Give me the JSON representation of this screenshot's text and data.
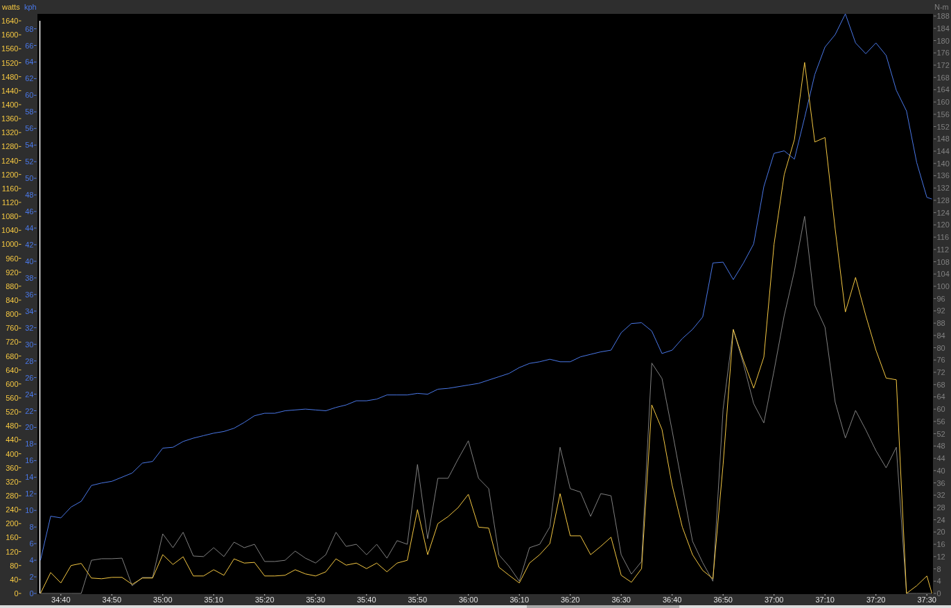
{
  "charts": [
    {
      "chart_data": {
        "type": "line",
        "ylabel": "watts",
        "x": [
          2076,
          2078,
          2080,
          2082,
          2084,
          2086,
          2088,
          2090,
          2092,
          2094,
          2096,
          2098,
          2100,
          2102,
          2104,
          2106,
          2108,
          2110,
          2112,
          2114,
          2116,
          2118,
          2120,
          2122,
          2124,
          2126,
          2128,
          2130,
          2132,
          2134,
          2136,
          2138,
          2140,
          2142,
          2144,
          2146,
          2148,
          2150,
          2152,
          2154,
          2156,
          2158,
          2160,
          2162,
          2164,
          2166,
          2168,
          2170,
          2172,
          2174,
          2176,
          2178,
          2180,
          2182,
          2184,
          2186,
          2188,
          2190,
          2192,
          2194,
          2196,
          2198,
          2200,
          2202,
          2204,
          2206,
          2208,
          2210,
          2212,
          2214,
          2216,
          2218,
          2220,
          2222,
          2224,
          2226,
          2228,
          2230,
          2232,
          2234,
          2236,
          2238,
          2240,
          2242,
          2244,
          2246,
          2248,
          2250,
          2251
        ],
        "xlim": [
          2075.4,
          2251.2
        ],
        "xticks": [
          {
            "value": 2080,
            "label": "34:40"
          },
          {
            "value": 2090,
            "label": "34:50"
          },
          {
            "value": 2100,
            "label": "35:00"
          },
          {
            "value": 2110,
            "label": "35:10"
          },
          {
            "value": 2120,
            "label": "35:20"
          },
          {
            "value": 2130,
            "label": "35:30"
          },
          {
            "value": 2140,
            "label": "35:40"
          },
          {
            "value": 2150,
            "label": "35:50"
          },
          {
            "value": 2160,
            "label": "36:00"
          },
          {
            "value": 2170,
            "label": "36:10"
          },
          {
            "value": 2180,
            "label": "36:20"
          },
          {
            "value": 2190,
            "label": "36:30"
          },
          {
            "value": 2200,
            "label": "36:40"
          },
          {
            "value": 2210,
            "label": "36:50"
          },
          {
            "value": 2220,
            "label": "37:00"
          },
          {
            "value": 2230,
            "label": "37:10"
          },
          {
            "value": 2240,
            "label": "37:20"
          },
          {
            "value": 2250,
            "label": "37:30"
          }
        ],
        "ylim": [
          0,
          1660
        ],
        "yticks": [
          0,
          40,
          80,
          120,
          160,
          200,
          240,
          280,
          320,
          360,
          400,
          440,
          480,
          520,
          560,
          600,
          640,
          680,
          720,
          760,
          800,
          840,
          880,
          920,
          960,
          1000,
          1040,
          1080,
          1120,
          1160,
          1200,
          1240,
          1280,
          1320,
          1360,
          1400,
          1440,
          1480,
          1520,
          1560,
          1600,
          1640
        ],
        "series": [
          {
            "color": "#f5c842",
            "values": [
              0,
              60,
              30,
              80,
              86,
              44,
              42,
              46,
              46,
              26,
              44,
              44,
              111,
              83,
              105,
              50,
              50,
              68,
              52,
              99,
              87,
              89,
              50,
              50,
              52,
              68,
              56,
              50,
              62,
              99,
              81,
              87,
              71,
              87,
              62,
              87,
              95,
              240,
              111,
              200,
              220,
              246,
              284,
              190,
              187,
              75,
              52,
              30,
              87,
              111,
              143,
              286,
              165,
              165,
              111,
              135,
              161,
              52,
              32,
              71,
              540,
              470,
              310,
              190,
              111,
              66,
              42,
              369,
              756,
              667,
              588,
              677,
              1000,
              1200,
              1300,
              1521,
              1293,
              1306,
              1044,
              806,
              905,
              796,
              697,
              617,
              612,
              0,
              22,
              50,
              0
            ]
          }
        ]
      }
    },
    {
      "chart_data": {
        "type": "line",
        "ylabel": "kph",
        "x": [
          2076,
          2078,
          2080,
          2082,
          2084,
          2086,
          2088,
          2090,
          2092,
          2094,
          2096,
          2098,
          2100,
          2102,
          2104,
          2106,
          2108,
          2110,
          2112,
          2114,
          2116,
          2118,
          2120,
          2122,
          2124,
          2126,
          2128,
          2130,
          2132,
          2134,
          2136,
          2138,
          2140,
          2142,
          2144,
          2146,
          2148,
          2150,
          2152,
          2154,
          2156,
          2158,
          2160,
          2162,
          2164,
          2166,
          2168,
          2170,
          2172,
          2174,
          2176,
          2178,
          2180,
          2182,
          2184,
          2186,
          2188,
          2190,
          2192,
          2194,
          2196,
          2198,
          2200,
          2202,
          2204,
          2206,
          2208,
          2210,
          2212,
          2214,
          2216,
          2218,
          2220,
          2222,
          2224,
          2226,
          2228,
          2230,
          2232,
          2234,
          2236,
          2238,
          2240,
          2242,
          2244,
          2246,
          2248,
          2250,
          2251
        ],
        "xlim": [
          2075.4,
          2251.2
        ],
        "ylim": [
          0,
          69.8
        ],
        "yticks": [
          0,
          2,
          4,
          6,
          8,
          10,
          12,
          14,
          16,
          18,
          20,
          22,
          24,
          26,
          28,
          30,
          32,
          34,
          36,
          38,
          40,
          42,
          44,
          46,
          48,
          50,
          52,
          54,
          56,
          58,
          60,
          62,
          64,
          66,
          68
        ],
        "series": [
          {
            "color": "#4a78e8",
            "values": [
              4,
              9.3,
              9.1,
              10.4,
              11.1,
              13,
              13.3,
              13.5,
              14,
              14.5,
              15.7,
              15.9,
              17.5,
              17.6,
              18.3,
              18.7,
              19,
              19.3,
              19.5,
              19.9,
              20.6,
              21.4,
              21.7,
              21.7,
              22,
              22.1,
              22.2,
              22.1,
              22,
              22.4,
              22.7,
              23.2,
              23.2,
              23.4,
              23.9,
              23.9,
              23.9,
              24.1,
              24,
              24.6,
              24.7,
              24.9,
              25.1,
              25.3,
              25.7,
              26.1,
              26.5,
              27.2,
              27.7,
              27.9,
              28.2,
              27.9,
              27.9,
              28.5,
              28.8,
              29.1,
              29.3,
              31.4,
              32.5,
              32.6,
              31.6,
              28.9,
              29.3,
              30.7,
              31.8,
              33.3,
              39.8,
              39.9,
              37.8,
              39.8,
              42.1,
              49,
              53,
              53.3,
              52.3,
              57.3,
              62.5,
              65.8,
              67.3,
              69.8,
              66.3,
              65,
              66.3,
              64.8,
              60.6,
              58.1,
              51.9,
              47.7,
              47.5
            ]
          }
        ]
      }
    },
    {
      "chart_data": {
        "type": "line",
        "ylabel": "N-m",
        "x": [
          2076,
          2078,
          2080,
          2082,
          2084,
          2086,
          2088,
          2090,
          2092,
          2094,
          2096,
          2098,
          2100,
          2102,
          2104,
          2106,
          2108,
          2110,
          2112,
          2114,
          2116,
          2118,
          2120,
          2122,
          2124,
          2126,
          2128,
          2130,
          2132,
          2134,
          2136,
          2138,
          2140,
          2142,
          2144,
          2146,
          2148,
          2150,
          2152,
          2154,
          2156,
          2158,
          2160,
          2162,
          2164,
          2166,
          2168,
          2170,
          2172,
          2174,
          2176,
          2178,
          2180,
          2182,
          2184,
          2186,
          2188,
          2190,
          2192,
          2194,
          2196,
          2198,
          2200,
          2202,
          2204,
          2206,
          2208,
          2210,
          2212,
          2214,
          2216,
          2218,
          2220,
          2222,
          2224,
          2226,
          2228,
          2230,
          2232,
          2234,
          2236,
          2238,
          2240,
          2242,
          2244,
          2246,
          2248,
          2250,
          2251
        ],
        "xlim": [
          2075.4,
          2251.2
        ],
        "ylim": [
          0,
          188.7
        ],
        "yticks": [
          0,
          4,
          8,
          12,
          16,
          20,
          24,
          28,
          32,
          36,
          40,
          44,
          48,
          52,
          56,
          60,
          64,
          68,
          72,
          76,
          80,
          84,
          88,
          92,
          96,
          100,
          104,
          108,
          112,
          116,
          120,
          124,
          128,
          132,
          136,
          140,
          144,
          148,
          152,
          156,
          160,
          164,
          168,
          172,
          176,
          180,
          184,
          188
        ],
        "series": [
          {
            "color": "#808080",
            "values": [
              0,
              0,
              0,
              0,
              0,
              10.8,
              11.3,
              11.3,
              11.5,
              2.5,
              5.2,
              5.2,
              19.4,
              14.9,
              19.9,
              12.2,
              12,
              14.9,
              12,
              16.7,
              14.9,
              16,
              10.4,
              10.4,
              10.8,
              13.8,
              11.5,
              9.9,
              12.6,
              19.9,
              15.3,
              16,
              12.6,
              16,
              11.5,
              17.2,
              16,
              42,
              17.8,
              37.5,
              37.5,
              43.8,
              49.7,
              37.5,
              34.1,
              12.6,
              8.8,
              4,
              14.9,
              16,
              21.7,
              47.6,
              34.1,
              33,
              25.1,
              32.5,
              31.8,
              12.6,
              6.3,
              10.4,
              75,
              70,
              53,
              35,
              17,
              10,
              4,
              60,
              86,
              74.7,
              61.8,
              55.5,
              72.5,
              90.5,
              105,
              122.8,
              93.9,
              86.7,
              62.3,
              50.6,
              59.6,
              53.3,
              46.5,
              40.9,
              47.6,
              0,
              0,
              0,
              0
            ]
          }
        ]
      }
    }
  ]
}
